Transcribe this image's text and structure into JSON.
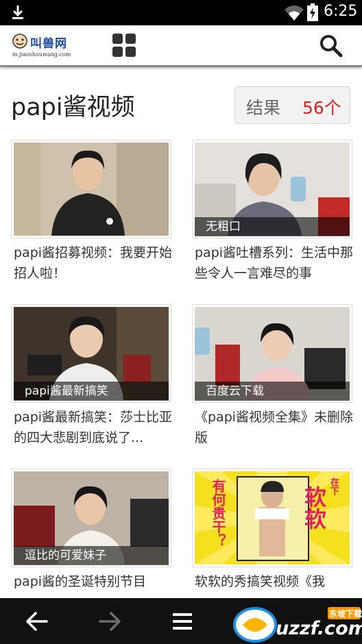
{
  "status_bar": {
    "time": "6:25"
  },
  "header": {
    "logo_name": "叫兽网",
    "logo_url": "m.jiaoshouwang.com"
  },
  "search": {
    "title": "papi酱视频",
    "result_label": "结果",
    "result_count": "56个"
  },
  "videos": [
    {
      "tag": "",
      "caption": "papi酱招募视频：我要开始招人啦！"
    },
    {
      "tag": "无粗口",
      "caption": "papi酱吐槽系列：生活中那些令人一言难尽的事"
    },
    {
      "tag": "papi酱最新搞笑",
      "caption": "papi酱最新搞笑：莎士比亚的四大悲剧到底说了..."
    },
    {
      "tag": "百度云下载",
      "caption": "《papi酱视频全集》未删除版"
    },
    {
      "tag": "逗比的可爱妹子",
      "caption": "papi酱的圣诞特别节目"
    },
    {
      "tag": "",
      "caption": "软软的秀搞笑视频《我",
      "poster_text": [
        "有何贵干？",
        "在下",
        "软软"
      ]
    }
  ],
  "watermark": {
    "text": "uzzf.com",
    "sub": "东坡下载"
  },
  "colors": {
    "accent_red": "#e02020",
    "logo_blue": "#1b4aa0"
  }
}
